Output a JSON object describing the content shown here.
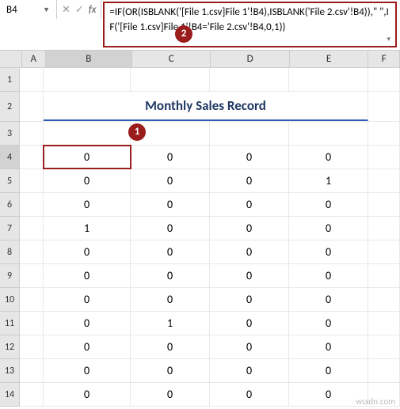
{
  "name_box": "B4",
  "formula": "=IF(OR(ISBLANK('[File 1.csv]File 1'!B4),ISBLANK('File 2.csv'!B4)),\"  \",IF('[File 1.csv]File 1'!B4='File 2.csv'!B4,0,1))",
  "columns": [
    "A",
    "B",
    "C",
    "D",
    "E",
    "F"
  ],
  "title": "Monthly Sales Record",
  "active_col": "B",
  "active_row": 4,
  "rows": [
    1,
    2,
    3,
    4,
    5,
    6,
    7,
    8,
    9,
    10,
    11,
    12,
    13,
    14
  ],
  "badges": {
    "b1": "1",
    "b2": "2"
  },
  "watermark": "wsxdn.com",
  "chart_data": {
    "type": "table",
    "title": "Monthly Sales Record",
    "columns": [
      "B",
      "C",
      "D",
      "E"
    ],
    "rows": [
      [
        0,
        0,
        0,
        0
      ],
      [
        0,
        0,
        0,
        1
      ],
      [
        0,
        0,
        0,
        0
      ],
      [
        1,
        0,
        0,
        0
      ],
      [
        0,
        0,
        0,
        0
      ],
      [
        0,
        0,
        0,
        0
      ],
      [
        0,
        0,
        0,
        0
      ],
      [
        0,
        1,
        0,
        0
      ],
      [
        0,
        0,
        0,
        0
      ],
      [
        0,
        0,
        0,
        0
      ],
      [
        0,
        0,
        0,
        0
      ]
    ]
  }
}
